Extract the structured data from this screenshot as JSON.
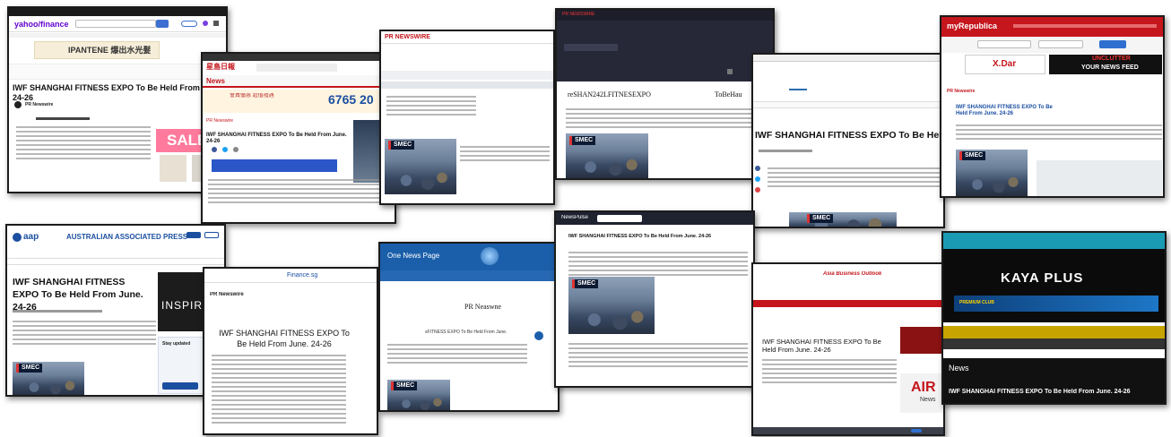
{
  "shots": {
    "s1": {
      "logo": "yahoo/finance",
      "banner": "IPANTENE 爆出水光髮",
      "headline": "IWF SHANGHAI FITNESS EXPO To Be Held From June. 24-26",
      "author": "PR Newswire",
      "sale": "SALE"
    },
    "s2": {
      "logo": "星島日報",
      "nav_label": "News",
      "phone": "6765 20",
      "tag": "PR Newswire",
      "headline": "IWF SHANGHAI FITNESS EXPO To Be Held From June. 24-26"
    },
    "s3": {
      "logo": "PR NEWSWIRE",
      "smec": "SMEC"
    },
    "s4": {
      "header": "PR NEWSWIRE",
      "line1": "reSHAN242LFITNESEXPO",
      "line2": "ToBeHau",
      "smec": "SMEC"
    },
    "s5": {
      "headline": "IWF SHANGHAI FITNESS EXPO To Be Held From",
      "smec": "SMEC"
    },
    "s6": {
      "logo": "myRepublica",
      "ad_left": "X.Dar",
      "ad_right_top": "UNCLUTTER",
      "ad_right_bottom": "YOUR NEWS FEED",
      "tag": "PR Newswire",
      "headline": "IWF SHANGHAI FITNESS EXPO To Be Held From June. 24-26"
    },
    "s7": {
      "logo": "aap",
      "title": "AUSTRALIAN ASSOCIATED PRESS",
      "headline": "IWF SHANGHAI FITNESS EXPO To Be Held From June. 24-26",
      "side": "INSPIRIN",
      "smec": "SMEC",
      "subscribe": "Stay updated"
    },
    "s8": {
      "site": "Finance.sg",
      "tag": "PR Newswire",
      "headline": "IWF SHANGHAI FITNESS EXPO To Be Held From June. 24-26"
    },
    "s9": {
      "site": "One News Page",
      "byline": "PR Neaswne",
      "subhead": "sFITNESS EXPO To Be Held From June.",
      "smec": "SMEC"
    },
    "s10": {
      "site": "NewsPulse",
      "headline": "IWF SHANGHAI FITNESS EXPO To Be Held From June. 24-26",
      "smec": "SMEC"
    },
    "s11": {
      "logo": "Asia Business Outlook",
      "headline": "IWF SHANGHAI FITNESS EXPO To Be Held From June. 24-26",
      "ad": "AIR",
      "ad_sub": "News"
    },
    "s12": {
      "brand": "KAYA PLUS",
      "section": "News",
      "headline": "IWF SHANGHAI FITNESS EXPO To Be Held From June. 24-26",
      "promo": "PREMIUM CLUB"
    }
  },
  "colors": {
    "yahoo_purple": "#5f01d1",
    "red_brand": "#c4161c",
    "dark_nav": "#1f2330",
    "aap_blue": "#1b4fa0",
    "onenews_blue": "#1b5faa",
    "kaya_teal": "#1a9bb3"
  }
}
